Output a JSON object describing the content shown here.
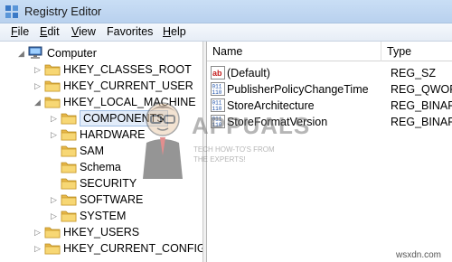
{
  "window": {
    "title": "Registry Editor"
  },
  "menu": [
    {
      "label": "File",
      "u": "F",
      "rest": "ile"
    },
    {
      "label": "Edit",
      "u": "E",
      "rest": "dit"
    },
    {
      "label": "View",
      "u": "V",
      "rest": "iew"
    },
    {
      "label": "Favorites",
      "u": "",
      "rest": "Favorites"
    },
    {
      "label": "Help",
      "u": "H",
      "rest": "elp"
    }
  ],
  "tree": {
    "root": "Computer",
    "keys": [
      "HKEY_CLASSES_ROOT",
      "HKEY_CURRENT_USER",
      "HKEY_LOCAL_MACHINE",
      "COMPONENTS",
      "HARDWARE",
      "SAM",
      "Schema",
      "SECURITY",
      "SOFTWARE",
      "SYSTEM",
      "HKEY_USERS",
      "HKEY_CURRENT_CONFIG"
    ],
    "selected": "COMPONENTS"
  },
  "list": {
    "columns": [
      "Name",
      "Type"
    ],
    "rows": [
      {
        "name": "(Default)",
        "type": "REG_SZ",
        "icon": "string-value-icon"
      },
      {
        "name": "PublisherPolicyChangeTime",
        "type": "REG_QWORD",
        "icon": "binary-value-icon"
      },
      {
        "name": "StoreArchitecture",
        "type": "REG_BINARY",
        "icon": "binary-value-icon"
      },
      {
        "name": "StoreFormatVersion",
        "type": "REG_BINARY",
        "icon": "binary-value-icon"
      }
    ]
  },
  "watermark": {
    "brand": "APPUALS",
    "tagline_1": "TECH HOW-TO'S FROM",
    "tagline_2": "THE EXPERTS!",
    "url": "wsxdn.com"
  }
}
